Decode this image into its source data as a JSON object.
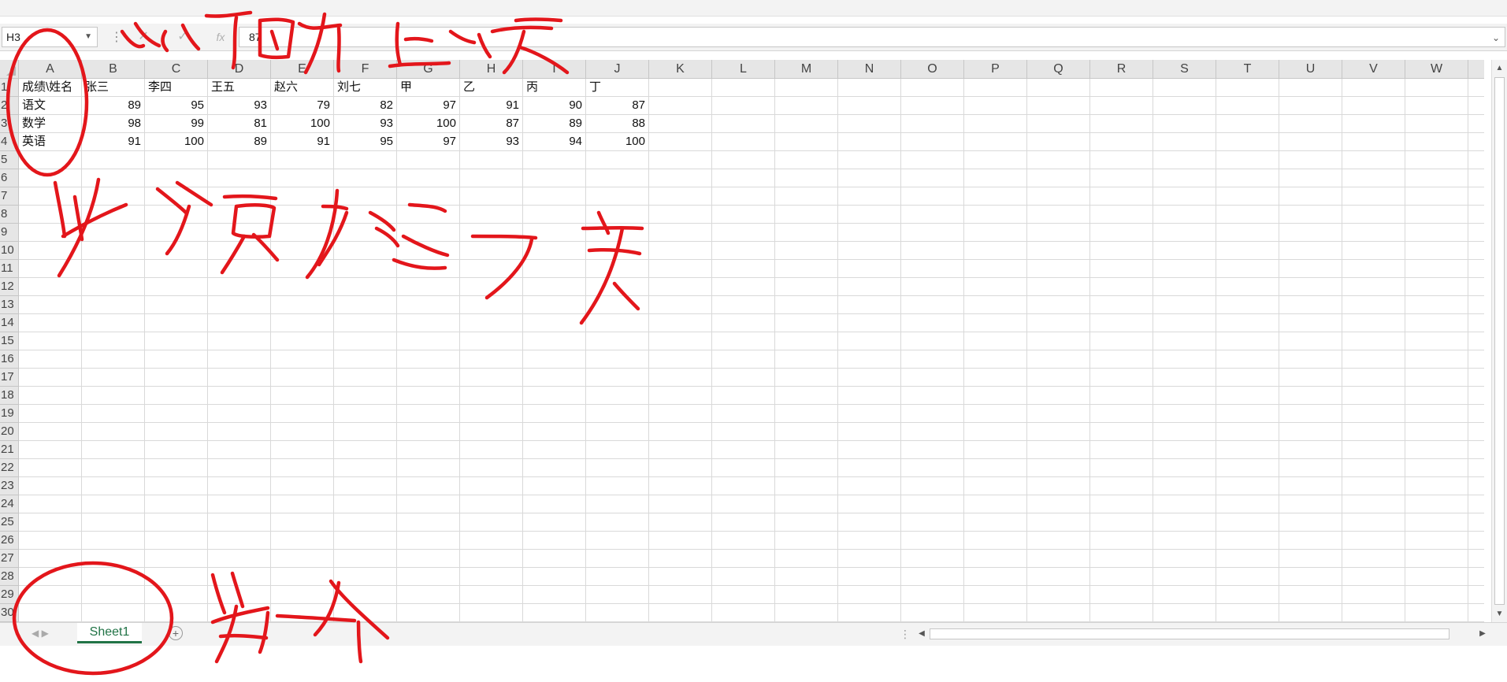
{
  "formula_bar": {
    "name_box": "H3",
    "cancel_icon": "x-icon",
    "enter_icon": "check-icon",
    "fx_label": "fx",
    "formula": "87"
  },
  "columns": [
    "A",
    "B",
    "C",
    "D",
    "E",
    "F",
    "G",
    "H",
    "I",
    "J",
    "K",
    "L",
    "M",
    "N",
    "O",
    "P",
    "Q",
    "R",
    "S",
    "T",
    "U",
    "V",
    "W"
  ],
  "rows": [
    "1",
    "2",
    "3",
    "4",
    "5",
    "6",
    "7",
    "8",
    "9",
    "10",
    "11",
    "12",
    "13",
    "14",
    "15",
    "16",
    "17",
    "18",
    "19",
    "20",
    "21",
    "22",
    "23",
    "24",
    "25",
    "26",
    "27",
    "28",
    "29",
    "30"
  ],
  "sheet": {
    "header": [
      "成绩\\姓名",
      "张三",
      "李四",
      "王五",
      "赵六",
      "刘七",
      "甲",
      "乙",
      "丙",
      "丁"
    ],
    "data": [
      {
        "label": "语文",
        "values": [
          "89",
          "95",
          "93",
          "79",
          "82",
          "97",
          "91",
          "90",
          "87"
        ]
      },
      {
        "label": "数学",
        "values": [
          "98",
          "99",
          "81",
          "100",
          "93",
          "100",
          "87",
          "89",
          "88"
        ]
      },
      {
        "label": "英语",
        "values": [
          "91",
          "100",
          "89",
          "91",
          "95",
          "97",
          "93",
          "94",
          "100"
        ]
      }
    ]
  },
  "tabs": {
    "sheets": [
      "Sheet1"
    ],
    "add_label": "+"
  }
}
